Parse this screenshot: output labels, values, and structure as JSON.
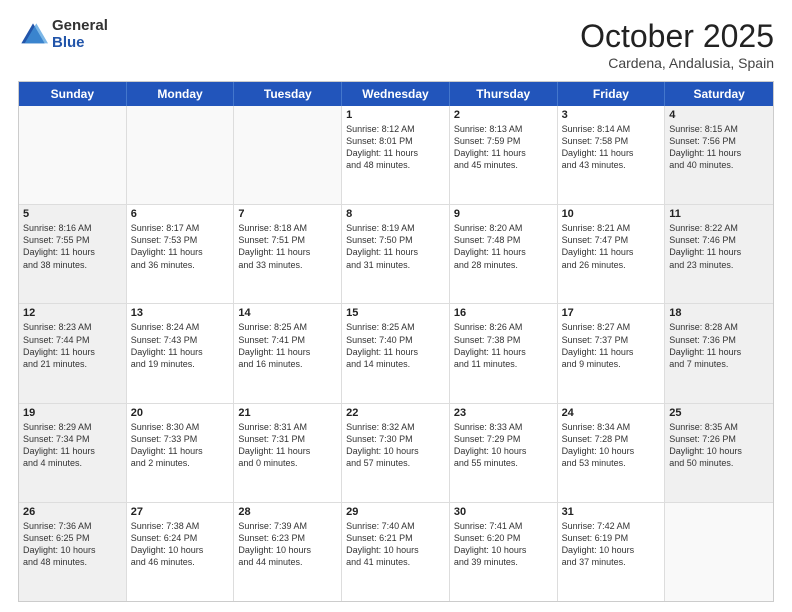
{
  "header": {
    "logo_general": "General",
    "logo_blue": "Blue",
    "month_title": "October 2025",
    "location": "Cardena, Andalusia, Spain"
  },
  "weekdays": [
    "Sunday",
    "Monday",
    "Tuesday",
    "Wednesday",
    "Thursday",
    "Friday",
    "Saturday"
  ],
  "rows": [
    [
      {
        "day": "",
        "text": "",
        "shaded": false,
        "empty": true
      },
      {
        "day": "",
        "text": "",
        "shaded": false,
        "empty": true
      },
      {
        "day": "",
        "text": "",
        "shaded": false,
        "empty": true
      },
      {
        "day": "1",
        "text": "Sunrise: 8:12 AM\nSunset: 8:01 PM\nDaylight: 11 hours\nand 48 minutes.",
        "shaded": false,
        "empty": false
      },
      {
        "day": "2",
        "text": "Sunrise: 8:13 AM\nSunset: 7:59 PM\nDaylight: 11 hours\nand 45 minutes.",
        "shaded": false,
        "empty": false
      },
      {
        "day": "3",
        "text": "Sunrise: 8:14 AM\nSunset: 7:58 PM\nDaylight: 11 hours\nand 43 minutes.",
        "shaded": false,
        "empty": false
      },
      {
        "day": "4",
        "text": "Sunrise: 8:15 AM\nSunset: 7:56 PM\nDaylight: 11 hours\nand 40 minutes.",
        "shaded": true,
        "empty": false
      }
    ],
    [
      {
        "day": "5",
        "text": "Sunrise: 8:16 AM\nSunset: 7:55 PM\nDaylight: 11 hours\nand 38 minutes.",
        "shaded": true,
        "empty": false
      },
      {
        "day": "6",
        "text": "Sunrise: 8:17 AM\nSunset: 7:53 PM\nDaylight: 11 hours\nand 36 minutes.",
        "shaded": false,
        "empty": false
      },
      {
        "day": "7",
        "text": "Sunrise: 8:18 AM\nSunset: 7:51 PM\nDaylight: 11 hours\nand 33 minutes.",
        "shaded": false,
        "empty": false
      },
      {
        "day": "8",
        "text": "Sunrise: 8:19 AM\nSunset: 7:50 PM\nDaylight: 11 hours\nand 31 minutes.",
        "shaded": false,
        "empty": false
      },
      {
        "day": "9",
        "text": "Sunrise: 8:20 AM\nSunset: 7:48 PM\nDaylight: 11 hours\nand 28 minutes.",
        "shaded": false,
        "empty": false
      },
      {
        "day": "10",
        "text": "Sunrise: 8:21 AM\nSunset: 7:47 PM\nDaylight: 11 hours\nand 26 minutes.",
        "shaded": false,
        "empty": false
      },
      {
        "day": "11",
        "text": "Sunrise: 8:22 AM\nSunset: 7:46 PM\nDaylight: 11 hours\nand 23 minutes.",
        "shaded": true,
        "empty": false
      }
    ],
    [
      {
        "day": "12",
        "text": "Sunrise: 8:23 AM\nSunset: 7:44 PM\nDaylight: 11 hours\nand 21 minutes.",
        "shaded": true,
        "empty": false
      },
      {
        "day": "13",
        "text": "Sunrise: 8:24 AM\nSunset: 7:43 PM\nDaylight: 11 hours\nand 19 minutes.",
        "shaded": false,
        "empty": false
      },
      {
        "day": "14",
        "text": "Sunrise: 8:25 AM\nSunset: 7:41 PM\nDaylight: 11 hours\nand 16 minutes.",
        "shaded": false,
        "empty": false
      },
      {
        "day": "15",
        "text": "Sunrise: 8:25 AM\nSunset: 7:40 PM\nDaylight: 11 hours\nand 14 minutes.",
        "shaded": false,
        "empty": false
      },
      {
        "day": "16",
        "text": "Sunrise: 8:26 AM\nSunset: 7:38 PM\nDaylight: 11 hours\nand 11 minutes.",
        "shaded": false,
        "empty": false
      },
      {
        "day": "17",
        "text": "Sunrise: 8:27 AM\nSunset: 7:37 PM\nDaylight: 11 hours\nand 9 minutes.",
        "shaded": false,
        "empty": false
      },
      {
        "day": "18",
        "text": "Sunrise: 8:28 AM\nSunset: 7:36 PM\nDaylight: 11 hours\nand 7 minutes.",
        "shaded": true,
        "empty": false
      }
    ],
    [
      {
        "day": "19",
        "text": "Sunrise: 8:29 AM\nSunset: 7:34 PM\nDaylight: 11 hours\nand 4 minutes.",
        "shaded": true,
        "empty": false
      },
      {
        "day": "20",
        "text": "Sunrise: 8:30 AM\nSunset: 7:33 PM\nDaylight: 11 hours\nand 2 minutes.",
        "shaded": false,
        "empty": false
      },
      {
        "day": "21",
        "text": "Sunrise: 8:31 AM\nSunset: 7:31 PM\nDaylight: 11 hours\nand 0 minutes.",
        "shaded": false,
        "empty": false
      },
      {
        "day": "22",
        "text": "Sunrise: 8:32 AM\nSunset: 7:30 PM\nDaylight: 10 hours\nand 57 minutes.",
        "shaded": false,
        "empty": false
      },
      {
        "day": "23",
        "text": "Sunrise: 8:33 AM\nSunset: 7:29 PM\nDaylight: 10 hours\nand 55 minutes.",
        "shaded": false,
        "empty": false
      },
      {
        "day": "24",
        "text": "Sunrise: 8:34 AM\nSunset: 7:28 PM\nDaylight: 10 hours\nand 53 minutes.",
        "shaded": false,
        "empty": false
      },
      {
        "day": "25",
        "text": "Sunrise: 8:35 AM\nSunset: 7:26 PM\nDaylight: 10 hours\nand 50 minutes.",
        "shaded": true,
        "empty": false
      }
    ],
    [
      {
        "day": "26",
        "text": "Sunrise: 7:36 AM\nSunset: 6:25 PM\nDaylight: 10 hours\nand 48 minutes.",
        "shaded": true,
        "empty": false
      },
      {
        "day": "27",
        "text": "Sunrise: 7:38 AM\nSunset: 6:24 PM\nDaylight: 10 hours\nand 46 minutes.",
        "shaded": false,
        "empty": false
      },
      {
        "day": "28",
        "text": "Sunrise: 7:39 AM\nSunset: 6:23 PM\nDaylight: 10 hours\nand 44 minutes.",
        "shaded": false,
        "empty": false
      },
      {
        "day": "29",
        "text": "Sunrise: 7:40 AM\nSunset: 6:21 PM\nDaylight: 10 hours\nand 41 minutes.",
        "shaded": false,
        "empty": false
      },
      {
        "day": "30",
        "text": "Sunrise: 7:41 AM\nSunset: 6:20 PM\nDaylight: 10 hours\nand 39 minutes.",
        "shaded": false,
        "empty": false
      },
      {
        "day": "31",
        "text": "Sunrise: 7:42 AM\nSunset: 6:19 PM\nDaylight: 10 hours\nand 37 minutes.",
        "shaded": false,
        "empty": false
      },
      {
        "day": "",
        "text": "",
        "shaded": true,
        "empty": true
      }
    ]
  ]
}
